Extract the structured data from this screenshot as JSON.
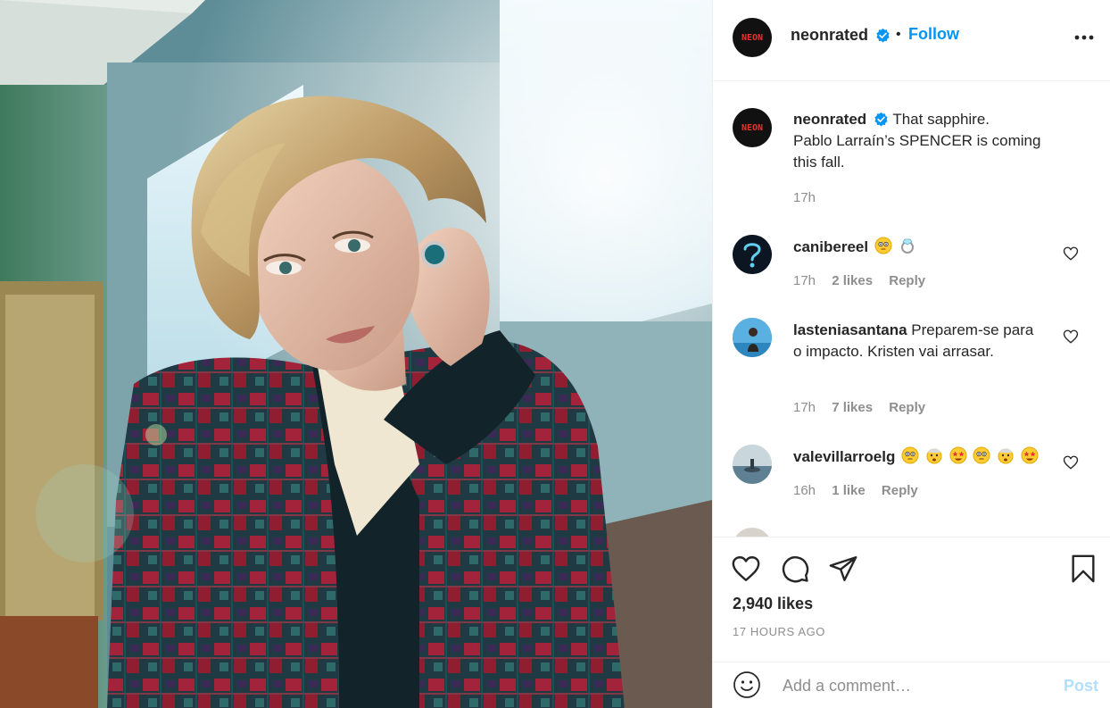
{
  "header": {
    "avatar_text": "NEON",
    "username": "neonrated",
    "follow_label": "Follow",
    "separator": "•"
  },
  "caption": {
    "username": "neonrated",
    "text_line1": "That sapphire.",
    "text_rest": "Pablo Larraín’s SPENCER is coming this fall.",
    "time": "17h"
  },
  "comments": [
    {
      "username": "canibereel",
      "text": "",
      "emojis": [
        "flushed-face",
        "ring"
      ],
      "time": "17h",
      "likes": "2 likes",
      "reply": "Reply"
    },
    {
      "username": "lasteniasantana",
      "text": "Preparem-se para o impacto. Kristen vai arrasar.",
      "emojis": [],
      "time": "17h",
      "likes": "7 likes",
      "reply": "Reply"
    },
    {
      "username": "valevillarroelg",
      "text": "",
      "emojis": [
        "flushed-face",
        "exploding-head",
        "star-struck",
        "flushed-face",
        "exploding-head",
        "star-struck"
      ],
      "time": "16h",
      "likes": "1 like",
      "reply": "Reply"
    }
  ],
  "actions": {
    "likes": "2,940 likes",
    "time_ago": "17 HOURS AGO"
  },
  "add_comment": {
    "placeholder": "Add a comment…",
    "post_label": "Post"
  },
  "colors": {
    "accent": "#0095f6",
    "post_disabled": "#b2dffc",
    "muted": "#8e8e8e",
    "text": "#262626",
    "neon_red": "#e8322b"
  },
  "icons": [
    "verified-badge-icon",
    "more-options-icon",
    "heart-icon",
    "comment-icon",
    "share-icon",
    "bookmark-icon",
    "smiley-icon"
  ]
}
